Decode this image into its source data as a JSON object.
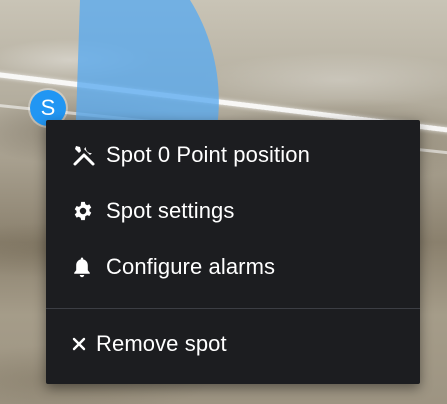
{
  "spot_marker": {
    "letter": "S",
    "zone_color": "#5aaaf0",
    "marker_color": "#2196f3"
  },
  "context_menu": {
    "items": [
      {
        "label": "Spot 0 Point position",
        "icon": "tools-icon"
      },
      {
        "label": "Spot settings",
        "icon": "gear-icon"
      },
      {
        "label": "Configure alarms",
        "icon": "bell-icon"
      },
      {
        "label": "Remove spot",
        "icon": "close-icon"
      }
    ]
  }
}
